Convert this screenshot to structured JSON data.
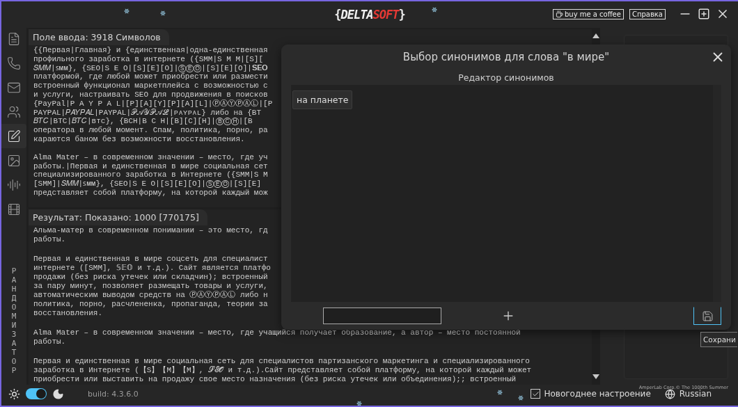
{
  "window": {
    "logo": {
      "open": "{",
      "brand_a": "DELTA",
      "brand_b": "SOFT",
      "close": "}"
    },
    "buttons": [
      {
        "kind": "coffee",
        "label": "buy me a coffee"
      },
      {
        "kind": "help",
        "label": "Справка"
      }
    ]
  },
  "sidebar": {
    "items": [
      {
        "kind": "document",
        "selected": false
      },
      {
        "kind": "phone",
        "selected": false
      },
      {
        "kind": "mail",
        "selected": false
      },
      {
        "kind": "users",
        "selected": false
      },
      {
        "kind": "edit",
        "selected": true
      },
      {
        "kind": "image",
        "selected": false
      },
      {
        "kind": "audio",
        "selected": false
      },
      {
        "kind": "film",
        "selected": false
      }
    ],
    "vertical_label": "РАНДОМИЗАТОР"
  },
  "input_panel": {
    "title": "Поле ввода: 3918 Символов",
    "paragraphs": [
      [
        "{{Первая|Главная} и {единственная|одна-единственная",
        "профильного заработка в интернете ({SMM|S M M|[S][",
        "𝑆𝑀𝑀|ꜱᴍᴍ}, {SEO|S E O|[S][E][O]|ⓈⒺⓄ|[S][E][O]|𝐒𝐄𝐎",
        "платформой, где любой может приобрести или размести",
        "встроенный функционал маркетплейса с возможностью с",
        "и услуги, настраивать SEO для продвижения в поисков",
        "{PayPal|P A Y P A L|[P][A][Y][P][A][L]|ⓅⒶⓎⓅⒶⓁ|[P",
        "PAYPAL|𝑃𝐴𝑌𝑃𝐴𝐿|PAYPAL|𝒫𝒜𝒴𝒫𝒜ℒ|ᴘᴀʏᴘᴀʟ} либо на {BT",
        "𝐵𝑇𝐶|BTC|𝐵𝑇𝐶|ʙᴛᴄ}, {BCH|B C H|[B][C][H]|ⒷⒸⒽ|[B",
        "оператора в любой момент. Спам, политика, порно, ра",
        "караются баном без возможности восстановления."
      ],
      [
        "Alma Mater – в современном значении – место, где уч",
        "работы.|Первая и единственная в мире социальная сет",
        "специализированного заработка в Интернете ({SMM|S M",
        "[SMM]|𝑆𝑀𝑀|ꜱᴍᴍ}, {SEO|S E O|[S][E][O]|ⓈⒺⓄ|[S][E]",
        "представляет собой платформу, на которой каждый мож"
      ]
    ]
  },
  "result_panel": {
    "title": "Результат: Показано: 1000 [770175]",
    "paragraphs": [
      [
        "Альма-матер в современном понимании – это место, гд",
        "работы."
      ],
      [
        "Первая и единственная в мире соцсеть для специалист",
        "интернете ([SMM], 𝕊𝔼𝕆 и т.д.). Сайт является платфо",
        "продажи (без риска утечек или складчин); встроенный",
        "за пару минут, позволяет размещать товары и услуги,",
        "автоматическим выводом средств на ⓅⒶⓎⓅⒶⓁ либо н",
        "политика, порно, расчлененка, пропаганда, теории за",
        "восстановления."
      ],
      [
        "Alma Mater – в современном значении – место, где учащийся получает образование, а автор – место постоянной",
        "работы."
      ],
      [
        "Первая и единственная в мире социальная сеть для специалистов партизанского маркетинга и специализированного",
        "заработка в Интернете (【S】【M】【M】, 𝓢𝓔𝓞 и т.д.).Сайт представляет собой платформу, на которой каждый может",
        "приобрести или выставить на продажу свое место назначения (без риска утечек или объединения);; встроенный"
      ]
    ]
  },
  "dialog": {
    "title": "Выбор синонимов для слова \"в мире\"",
    "subtitle": "Редактор синонимов",
    "synonyms": [
      "на планете"
    ],
    "tooltip": "Сохрани"
  },
  "status_bar": {
    "dark_theme": {
      "on": true
    },
    "build": "build: 4.3.6.0",
    "festive_mood": {
      "label": "Новогоднее настроение",
      "checked": true
    },
    "language": "Russian",
    "credit": "AmperLab Corp.© The 1000th Summer"
  }
}
